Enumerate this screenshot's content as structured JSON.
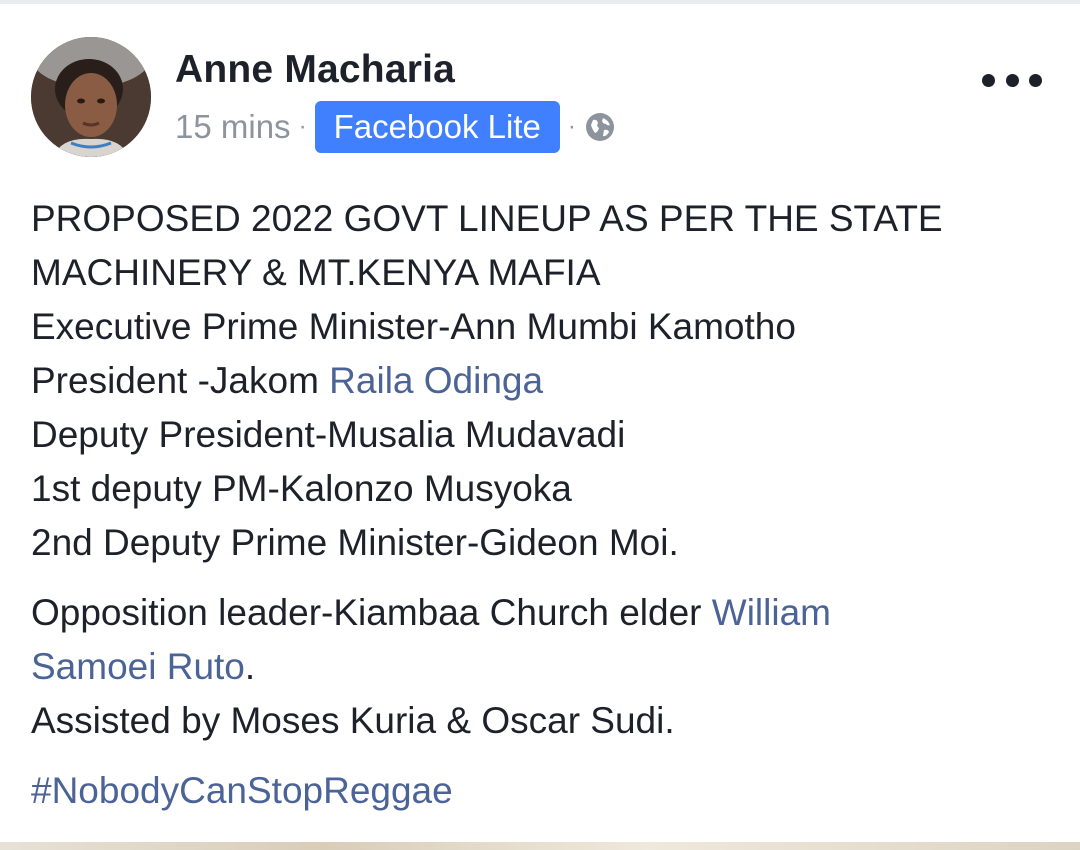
{
  "post": {
    "author": "Anne Macharia",
    "time": "15 mins",
    "separator": "·",
    "app_badge": "Facebook Lite",
    "audience_icon": "globe-icon",
    "more_icon": "more-horizontal-icon",
    "text": {
      "line1": "PROPOSED 2022 GOVT LINEUP AS PER THE STATE",
      "line2": "MACHINERY & MT.KENYA MAFIA",
      "line3": "Executive Prime Minister-Ann Mumbi Kamotho",
      "line4_prefix": "President -Jakom ",
      "line4_link": "Raila Odinga",
      "line5": "Deputy President-Musalia Mudavadi",
      "line6": "1st deputy PM-Kalonzo Musyoka",
      "line7": "2nd Deputy Prime Minister-Gideon Moi.",
      "line8_prefix": "Opposition leader-Kiambaa Church elder ",
      "line8_link": "William",
      "line9_link": "Samoei Ruto",
      "line9_suffix": ".",
      "line10": "Assisted by Moses Kuria & Oscar Sudi."
    },
    "hashtag": "#NobodyCanStopReggae"
  },
  "colors": {
    "link": "#4b6396",
    "badge_bg": "#4080ff",
    "text": "#1d2129",
    "meta": "#8d949e"
  }
}
